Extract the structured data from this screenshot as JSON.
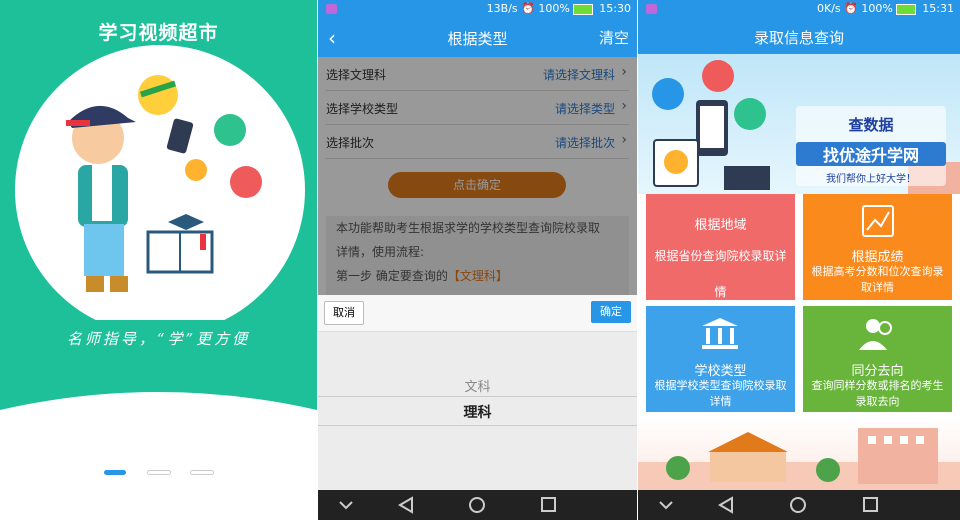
{
  "screen1": {
    "title": "学习视频超市",
    "slogan": "名师指导，“学”更方便"
  },
  "screen2": {
    "status": {
      "speed": "13B/s",
      "battery": "100%",
      "time": "15:30"
    },
    "header": {
      "back": "‹",
      "title": "根据类型",
      "clear": "清空"
    },
    "rows": [
      {
        "label": "选择文理科",
        "value": "请选择文理科"
      },
      {
        "label": "选择学校类型",
        "value": "请选择类型"
      },
      {
        "label": "选择批次",
        "value": "请选择批次"
      }
    ],
    "confirm": "点击确定",
    "description": {
      "line1": "本功能帮助考生根据求学的学校类型查询院校录取",
      "line2": "详情，使用流程:",
      "step_prefix": "第一步    确定要查询的",
      "step_highlight": "【文理科】"
    },
    "picker": {
      "cancel": "取消",
      "ok": "确定",
      "options": [
        "文科",
        "理科"
      ],
      "selected": "理科"
    }
  },
  "screen3": {
    "status": {
      "speed": "0K/s",
      "battery": "100%",
      "time": "15:31"
    },
    "header": {
      "title": "录取信息查询"
    },
    "banner": {
      "line1": "查数据",
      "line2": "找优途升学网",
      "line3": "我们帮你上好大学！"
    },
    "tiles": [
      {
        "title": "根据地域",
        "desc": "根据省份查询院校录取详情",
        "color": "#f06a6a"
      },
      {
        "title": "根据成绩",
        "desc": "根据高考分数和位次查询录取详情",
        "color": "#fb8a1c"
      },
      {
        "title": "学校类型",
        "desc": "根据学校类型查询院校录取详情",
        "color": "#3ea2ea"
      },
      {
        "title": "同分去向",
        "desc": "查询同样分数或排名的考生录取去向",
        "color": "#69b53b"
      }
    ]
  },
  "colors": {
    "green": "#1ec09a",
    "blue": "#2896e6",
    "orange": "#e07a1b"
  }
}
